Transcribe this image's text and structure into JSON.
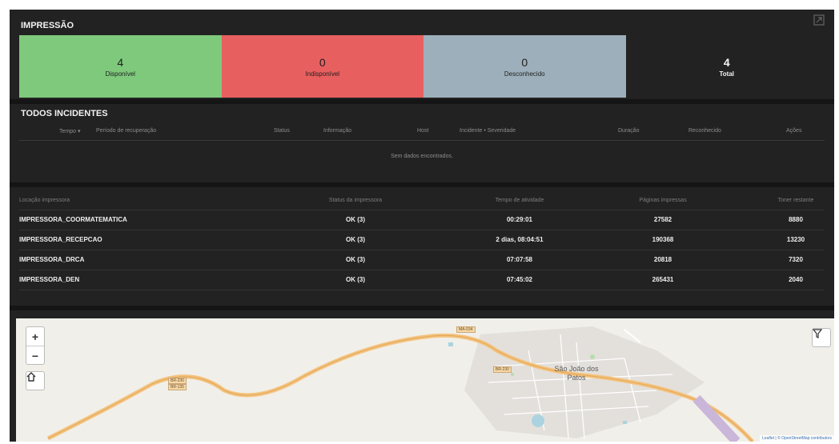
{
  "impressao": {
    "title": "IMPRESSÃO",
    "stats": [
      {
        "value": "4",
        "label": "Disponível",
        "color": "#7ec97c"
      },
      {
        "value": "0",
        "label": "Indisponível",
        "color": "#e85f5f"
      },
      {
        "value": "0",
        "label": "Desconhecido",
        "color": "#9dafba"
      },
      {
        "value": "4",
        "label": "Total",
        "color": "#222222"
      }
    ]
  },
  "incidentes": {
    "title": "TODOS INCIDENTES",
    "headers": [
      "Tempo ▾",
      "Período de recuperação",
      "Status",
      "Informação",
      "Host",
      "Incidente • Severidade",
      "Duração",
      "Reconhecido",
      "Ações"
    ],
    "empty": "Sem dados encontrados."
  },
  "printers": {
    "headers": [
      "Locação impressora",
      "Status da impressora",
      "Tempo de atividade",
      "Páginas impressas",
      "Toner restante"
    ],
    "rows": [
      {
        "name": "IMPRESSORA_COORMATEMATICA",
        "status": "OK (3)",
        "uptime": "00:29:01",
        "pages": "27582",
        "toner": "8880"
      },
      {
        "name": "IMPRESSORA_RECEPCAO",
        "status": "OK (3)",
        "uptime": "2 dias, 08:04:51",
        "pages": "190368",
        "toner": "13230"
      },
      {
        "name": "IMPRESSORA_DRCA",
        "status": "OK (3)",
        "uptime": "07:07:58",
        "pages": "20818",
        "toner": "7320"
      },
      {
        "name": "IMPRESSORA_DEN",
        "status": "OK (3)",
        "uptime": "07:45:02",
        "pages": "265431",
        "toner": "2040"
      }
    ]
  },
  "map": {
    "zoom_in": "+",
    "zoom_out": "−",
    "city": "São João dos Patos",
    "road_badges": [
      "BR-230",
      "BR-135",
      "MA-034"
    ],
    "attribution": "Leaflet | © OpenStreetMap contributors"
  }
}
